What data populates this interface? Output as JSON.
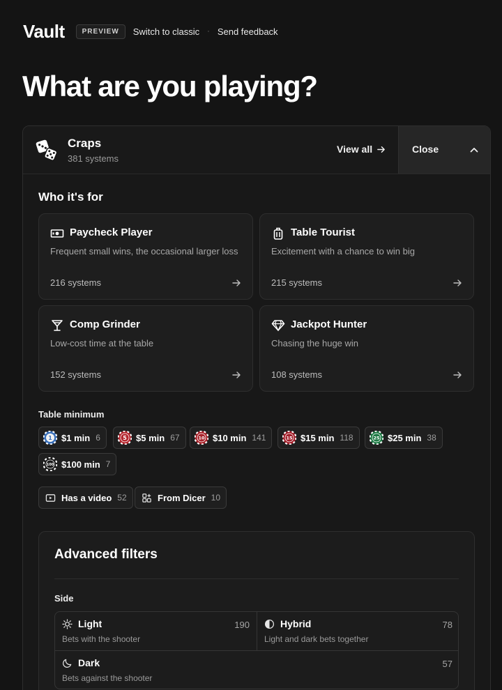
{
  "header": {
    "logo": "Vault",
    "badge": "PREVIEW",
    "switch_link": "Switch to classic",
    "separator": "·",
    "feedback_link": "Send feedback"
  },
  "page_title": "What are you playing?",
  "game": {
    "name": "Craps",
    "count": "381 systems",
    "view_all": "View all",
    "close": "Close",
    "icon": "dice-icon"
  },
  "who_for": {
    "title": "Who it's for",
    "personas": [
      {
        "title": "Paycheck Player",
        "desc": "Frequent small wins, the occasional larger loss",
        "count": "216 systems",
        "icon": "money-icon"
      },
      {
        "title": "Table Tourist",
        "desc": "Excitement with a chance to win big",
        "count": "215 systems",
        "icon": "luggage-icon"
      },
      {
        "title": "Comp Grinder",
        "desc": "Low-cost time at the table",
        "count": "152 systems",
        "icon": "cocktail-icon"
      },
      {
        "title": "Jackpot Hunter",
        "desc": "Chasing the huge win",
        "count": "108 systems",
        "icon": "diamond-icon"
      }
    ]
  },
  "table_minimum": {
    "label": "Table minimum",
    "chips": [
      {
        "label": "$1 min",
        "count": "6",
        "chip_text": "1",
        "color": "#3a6fb8"
      },
      {
        "label": "$5 min",
        "count": "67",
        "chip_text": "5",
        "color": "#b3262e"
      },
      {
        "label": "$10 min",
        "count": "141",
        "chip_text": "10",
        "color": "#a8232b"
      },
      {
        "label": "$15 min",
        "count": "118",
        "chip_text": "15",
        "color": "#a21f2a"
      },
      {
        "label": "$25 min",
        "count": "38",
        "chip_text": "25",
        "color": "#1f7a45"
      },
      {
        "label": "$100 min",
        "count": "7",
        "chip_text": "100",
        "color": "#1a1a1a"
      }
    ]
  },
  "extra_filters": [
    {
      "label": "Has a video",
      "count": "52",
      "icon": "video-icon"
    },
    {
      "label": "From Dicer",
      "count": "10",
      "icon": "apps-icon"
    }
  ],
  "advanced": {
    "title": "Advanced filters",
    "side_label": "Side",
    "sides": [
      {
        "title": "Light",
        "desc": "Bets with the shooter",
        "count": "190",
        "icon": "sun-icon"
      },
      {
        "title": "Hybrid",
        "desc": "Light and dark bets together",
        "count": "78",
        "icon": "half-circle-icon"
      },
      {
        "title": "Dark",
        "desc": "Bets against the shooter",
        "count": "57",
        "icon": "moon-icon"
      }
    ]
  }
}
